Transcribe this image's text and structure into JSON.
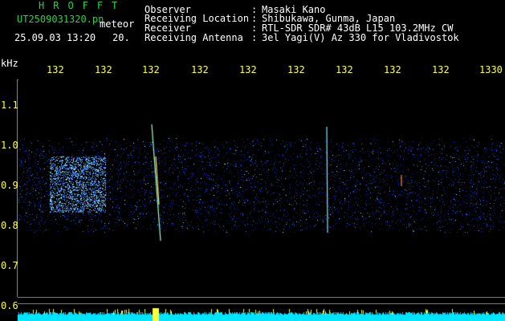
{
  "header": {
    "app_name": "HROFFT",
    "file_name": "UT2509031320.pn",
    "tag": "meteor",
    "date_time": "25.09.03 13:20",
    "counter": "20."
  },
  "info": [
    {
      "label": "Observer",
      "value": "Masaki Kano"
    },
    {
      "label": "Receiving Location",
      "value": "Shibukawa, Gunma, Japan"
    },
    {
      "label": "Receiver",
      "value": "RTL-SDR SDR# 43dB L15 103.2MHz CW"
    },
    {
      "label": "Receiving Antenna",
      "value": "3el Yagi(V) Az 330 for Vladivostok"
    }
  ],
  "axis": {
    "unit": "kHz",
    "x_ticks": [
      "132",
      "132",
      "132",
      "132",
      "132",
      "132",
      "132",
      "132",
      "132",
      "1330"
    ],
    "y_ticks": [
      "1.1",
      "1.0",
      "0.9",
      "0.8",
      "0.7",
      "0.6"
    ]
  },
  "colors": {
    "background": "#000000",
    "label_text": "#ffffff",
    "title_text": "#29d24a",
    "axis_text": "#ffff3a",
    "noise_band": "#1f3fd8",
    "signal_floor": "#00e5ff"
  }
}
